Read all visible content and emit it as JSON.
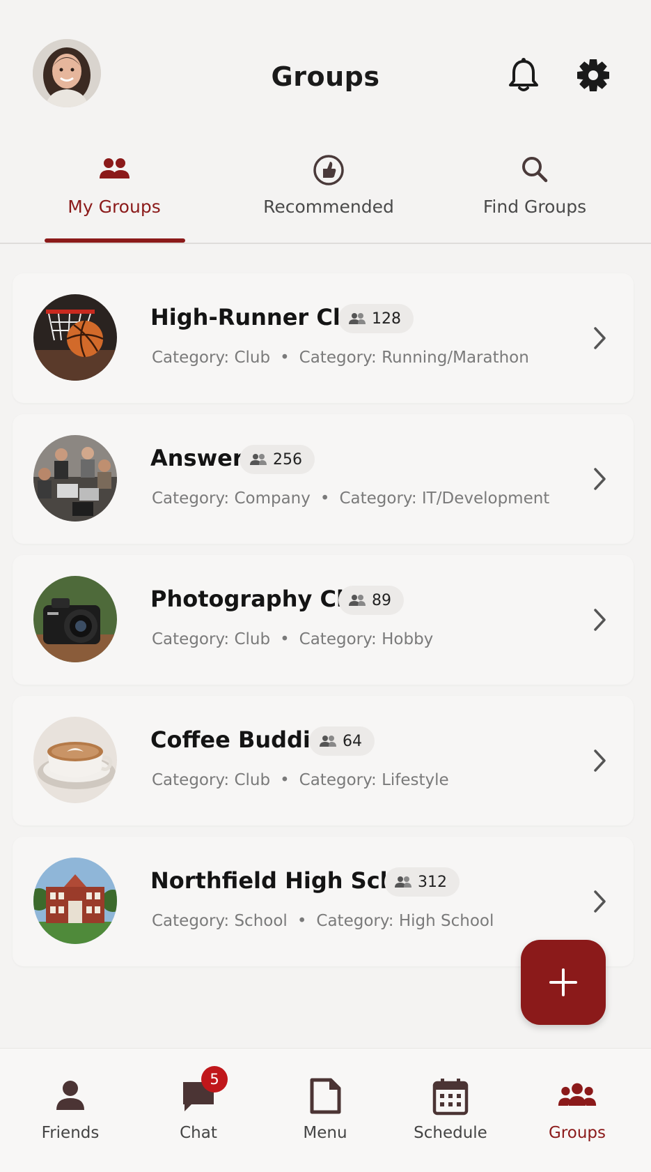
{
  "header": {
    "title": "Groups",
    "avatar_icon": "user-avatar",
    "notification_icon": "bell-icon",
    "settings_icon": "gear-icon"
  },
  "tabs": [
    {
      "label": "My Groups",
      "icon": "people-icon",
      "active": true
    },
    {
      "label": "Recommended",
      "icon": "thumbs-up-icon",
      "active": false
    },
    {
      "label": "Find Groups",
      "icon": "search-icon",
      "active": false
    }
  ],
  "groups": [
    {
      "name": "High-Runner Club",
      "members": "128",
      "cat1": "Category: Club",
      "cat2": "Category: Running/Marathon",
      "thumb": "basketball"
    },
    {
      "name": "Answer",
      "members": "256",
      "cat1": "Category: Company",
      "cat2": "Category: IT/Development",
      "thumb": "team-laptops"
    },
    {
      "name": "Photography Club",
      "members": "89",
      "cat1": "Category: Club",
      "cat2": "Category: Hobby",
      "thumb": "camera"
    },
    {
      "name": "Coffee Buddies",
      "members": "64",
      "cat1": "Category: Club",
      "cat2": "Category: Lifestyle",
      "thumb": "coffee-cup"
    },
    {
      "name": "Northfield High School",
      "members": "312",
      "cat1": "Category: School",
      "cat2": "Category: High School",
      "thumb": "school-building"
    }
  ],
  "separator": "•",
  "fab": {
    "icon": "plus-icon"
  },
  "bottom_nav": [
    {
      "label": "Friends",
      "icon": "person-icon",
      "active": false
    },
    {
      "label": "Chat",
      "icon": "chat-icon",
      "active": false,
      "badge": "5"
    },
    {
      "label": "Menu",
      "icon": "document-icon",
      "active": false
    },
    {
      "label": "Schedule",
      "icon": "calendar-icon",
      "active": false
    },
    {
      "label": "Groups",
      "icon": "groups-icon",
      "active": true
    }
  ],
  "colors": {
    "accent": "#8b1a1a",
    "background": "#f4f3f2",
    "badge_red": "#c0171b",
    "muted_text": "#7a7a7a"
  }
}
